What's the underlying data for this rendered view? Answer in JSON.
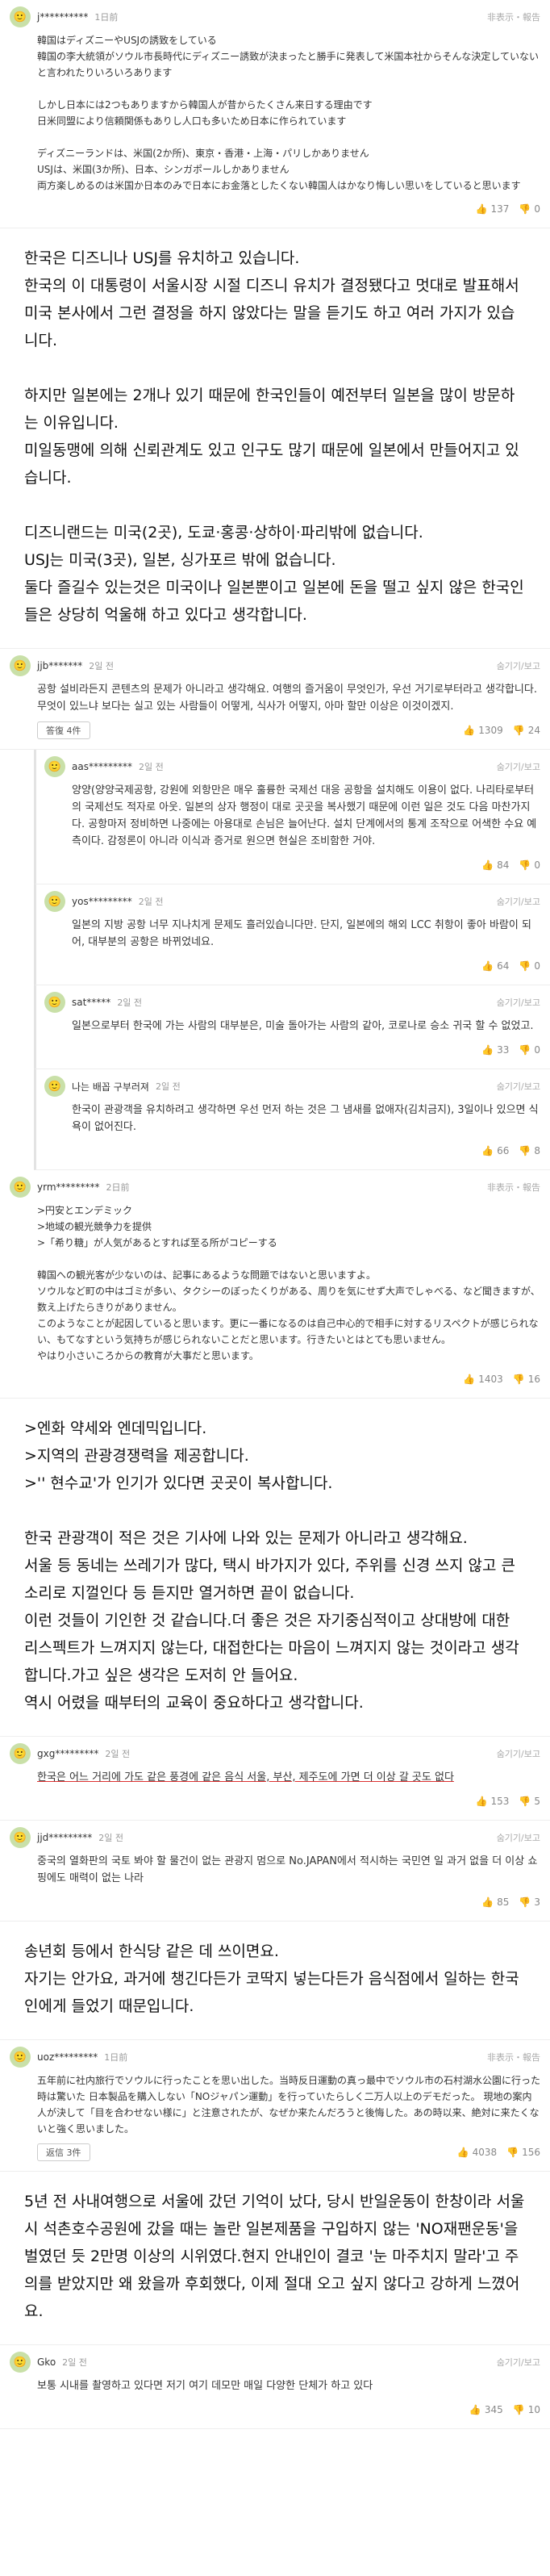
{
  "ui": {
    "report_label": "非表示・報告",
    "report_label_ko": "숨기기/보고",
    "reply_label": "答復 4件",
    "reply_label_2": "返信 3件"
  },
  "comments": [
    {
      "user": "j**********",
      "time": "1日前",
      "lang": "ja",
      "body": "韓国はディズニーやUSJの誘致をしている\n韓国の李大統領がソウル市長時代にディズニー誘致が決まったと勝手に発表して米国本社からそんな決定していないと言われたりいろいろあります\n\nしかし日本には2つもありますから韓国人が昔からたくさん来日する理由です\n日米同盟により信頼関係もありし人口も多いため日本に作られています\n\nディズニーランドは、米国(2か所)、東京・香港・上海・パリしかありません\nUSJは、米国(3か所)、日本、シンガポールしかありません\n両方楽しめるのは米国か日本のみで日本にお金落としたくない韓国人はかなり悔しい思いをしていると思います",
      "likes": "137",
      "dislikes": "0"
    },
    {
      "translation": "한국은 디즈니나 USJ를 유치하고 있습니다.\n한국의 이 대통령이 서울시장 시절 디즈니 유치가 결정됐다고 멋대로 발표해서 미국 본사에서 그런 결정을 하지 않았다는 말을 듣기도 하고 여러 가지가 있습니다.\n\n하지만 일본에는 2개나 있기 때문에 한국인들이 예전부터 일본을 많이 방문하는 이유입니다.\n미일동맹에 의해 신뢰관계도 있고 인구도 많기 때문에 일본에서 만들어지고 있습니다.\n\n디즈니랜드는 미국(2곳), 도쿄·홍콩·상하이·파리밖에 없습니다.\nUSJ는 미국(3곳), 일본, 싱가포르 밖에 없습니다.\n둘다 즐길수 있는것은 미국이나 일본뿐이고 일본에 돈을 떨고 싶지 않은 한국인들은 상당히 억울해 하고 있다고 생각합니다."
    },
    {
      "user": "jjb*******",
      "time": "2일 전",
      "lang": "ko",
      "body": "공항 설비라든지 콘텐츠의 문제가 아니라고 생각해요. 여행의 즐거움이 무엇인가, 우선 거기로부터라고 생각합니다. 무엇이 있느냐 보다는 실고 있는 사람들이 어떻게, 식사가 어떻지, 아마 할만 이상은 이것이겠지.",
      "likes": "1309",
      "dislikes": "24",
      "replies": true
    }
  ],
  "replies_1": [
    {
      "user": "aas*********",
      "time": "2일 전",
      "body": "양양(양양국제공항, 강원에 외항만은 매우 훌륭한 국제선 대응 공항을 설치해도 이용이 없다. 나리타로부터의 국제선도 적자로 아웃. 일본의 상자 행정이 대로 곳곳을 복사했기 때문에 이런 일은 것도 다음 마찬가지다. 공항마저 정비하면 나중에는 아용대로 손님은 늘어난다. 설치 단계에서의 통계 조작으로 어색한 수요 예측이다. 감정론이 아니라 이식과 증거로 원으면 현실은 조비함한 거야.",
      "likes": "84",
      "dislikes": "0"
    },
    {
      "user": "yos*********",
      "time": "2일 전",
      "body": "일본의 지방 공항 너무 지나치게 문제도 흘러있습니다만. 단지, 일본에의 해외 LCC 취항이 좋아 바람이 되어, 대부분의 공항은 바뀌었네요.",
      "likes": "64",
      "dislikes": "0"
    },
    {
      "user": "sat*****",
      "time": "2일 전",
      "body": "일본으로부터 한국에 가는 사람의 대부분은, 미술 돌아가는 사람의 같아, 코로나로 승소 귀국 할 수 없었고.",
      "likes": "33",
      "dislikes": "0"
    },
    {
      "user": "나는 배꼽 구부러져",
      "time": "2일 전",
      "body": "한국이 관광객을 유치하려고 생각하면 우선 먼저 하는 것은 그 냄새를 없애자(김치금지), 3일이나 있으면 식욕이 없어진다.",
      "likes": "66",
      "dislikes": "8"
    }
  ],
  "comment_yrm": {
    "user": "yrm*********",
    "time": "2日前",
    "lang": "ja",
    "body": ">円安とエンデミック\n>地域の観光競争力を提供\n>「希り糖」が人気があるとすれば至る所がコピーする\n\n韓国への観光客が少ないのは、記事にあるような問題ではないと思いますよ。\nソウルなど町の中はゴミが多い、タクシーのぼったくりがある、周りを気にせず大声でしゃべる、など聞きますが、数え上げたらきりがありません。\nこのようなことが起因していると思います。更に一番になるのは自己中心的で相手に対するリスペクトが感じられない、もてなすという気持ちが感じられないことだと思います。行きたいとはとても思いません。\nやはり小さいころからの教育が大事だと思います。",
    "likes": "1403",
    "dislikes": "16"
  },
  "translation_2": ">엔화 약세와 엔데믹입니다.\n>지역의 관광경쟁력을 제공합니다.\n>'' 현수교'가 인기가 있다면 곳곳이 복사합니다.\n\n한국 관광객이 적은 것은 기사에 나와 있는 문제가 아니라고 생각해요.\n서울 등 동네는 쓰레기가 많다, 택시 바가지가 있다, 주위를 신경 쓰지 않고 큰 소리로 지껄인다 등 듣지만 열거하면 끝이 없습니다.\n이런 것들이 기인한 것 같습니다.더 좋은 것은 자기중심적이고 상대방에 대한 리스펙트가 느껴지지 않는다, 대접한다는 마음이 느껴지지 않는 것이라고 생각합니다.가고 싶은 생각은 도저히 안 들어요.\n역시 어렸을 때부터의 교육이 중요하다고 생각합니다.",
  "comment_gxg": {
    "user": "gxg*********",
    "time": "2일 전",
    "body": "한국은 어느 거리에 가도 같은 풍경에 같은 음식 서울, 부산, 제주도에 가면 더 이상 갈 곳도 없다",
    "likes": "153",
    "dislikes": "5"
  },
  "comment_jjd": {
    "user": "jjd*********",
    "time": "2일 전",
    "body": "중국의 열화판의 국토 봐야 할 물건이 없는 관광지 멈으로 No.JAPAN에서 적시하는 국민연 일 과거 없을 더 이상 쇼핑에도 매력이 없는 나라",
    "likes": "85",
    "dislikes": "3"
  },
  "translation_3": "송년회 등에서 한식당 같은 데 쓰이면요.\n자기는 안가요, 과거에 챙긴다든가 코딱지 넣는다든가 음식점에서 일하는 한국인에게 들었기 때문입니다.",
  "comment_uoz": {
    "user": "uoz*********",
    "time": "1日前",
    "lang": "ja",
    "body": "五年前に社内旅行でソウルに行ったことを思い出した。当時反日運動の真っ最中でソウル市の石村湖水公園に行った時は驚いた 日本製品を購入しない「NOジャパン運動」を行っていたらしく二万人以上のデモだった。 現地の案内人が決して「目を合わせない様に」と注意されたが、なぜか来たんだろうと後悔した。あの時以来、絶対に来たくないと強く思いました。",
    "likes": "4038",
    "dislikes": "156"
  },
  "translation_4": "5년 전 사내여행으로 서울에 갔던 기억이 났다, 당시 반일운동이 한창이라 서울시 석촌호수공원에 갔을 때는 놀란 일본제품을 구입하지 않는 'NO재팬운동'을 벌였던 듯 2만명 이상의 시위였다.현지 안내인이 결코 '눈 마주치지 말라'고 주의를 받았지만 왜 왔을까 후회했다, 이제 절대 오고 싶지 않다고 강하게 느꼈어요.",
  "comment_gko": {
    "user": "Gko",
    "time": "2일 전",
    "body": "보통 시내를 촬영하고 있다면 저기 여기 데모만 매일 다양한 단체가 하고 있다",
    "likes": "345",
    "dislikes": "10"
  }
}
